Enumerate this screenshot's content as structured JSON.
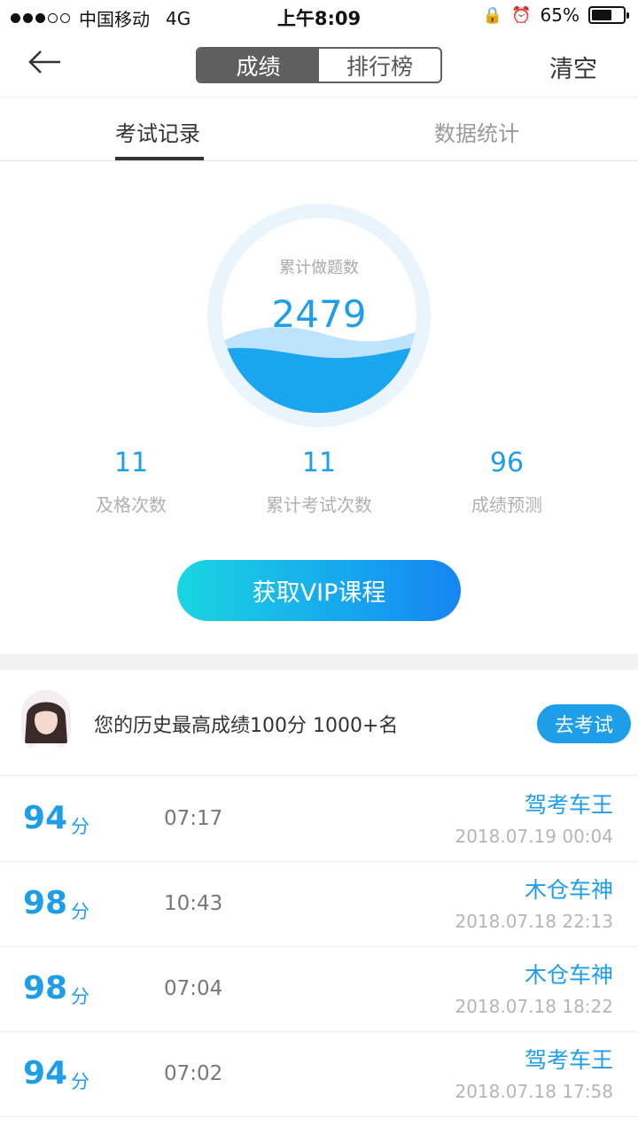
{
  "status_bar": {
    "carrier": "中国移动",
    "network": "4G",
    "time": "上午8:09",
    "battery": "65%",
    "battery_level": 0.65
  },
  "nav": {
    "segments": [
      "成绩",
      "排行榜"
    ],
    "active_segment": 0,
    "clear_label": "清空"
  },
  "tabs": {
    "items": [
      "考试记录",
      "数据统计"
    ],
    "active": 0
  },
  "gauge": {
    "label": "累计做题数",
    "value": "2479"
  },
  "stats": [
    {
      "value": "11",
      "label": "及格次数"
    },
    {
      "value": "11",
      "label": "累计考试次数"
    },
    {
      "value": "96",
      "label": "成绩预测"
    }
  ],
  "vip_button": "获取VIP课程",
  "best": {
    "text": "您的历史最高成绩100分  1000+名",
    "button": "去考试"
  },
  "records": [
    {
      "score": "94",
      "unit": "分",
      "duration": "07:17",
      "name": "驾考车王",
      "date": "2018.07.19 00:04"
    },
    {
      "score": "98",
      "unit": "分",
      "duration": "10:43",
      "name": "木仓车神",
      "date": "2018.07.18 22:13"
    },
    {
      "score": "98",
      "unit": "分",
      "duration": "07:04",
      "name": "木仓车神",
      "date": "2018.07.18 18:22"
    },
    {
      "score": "94",
      "unit": "分",
      "duration": "07:02",
      "name": "驾考车王",
      "date": "2018.07.18 17:58"
    }
  ],
  "colors": {
    "accent": "#1e9ee8",
    "segment_active": "#5f5f5f",
    "vip_gradient_start": "#1ad5e0",
    "vip_gradient_end": "#1585f2"
  }
}
